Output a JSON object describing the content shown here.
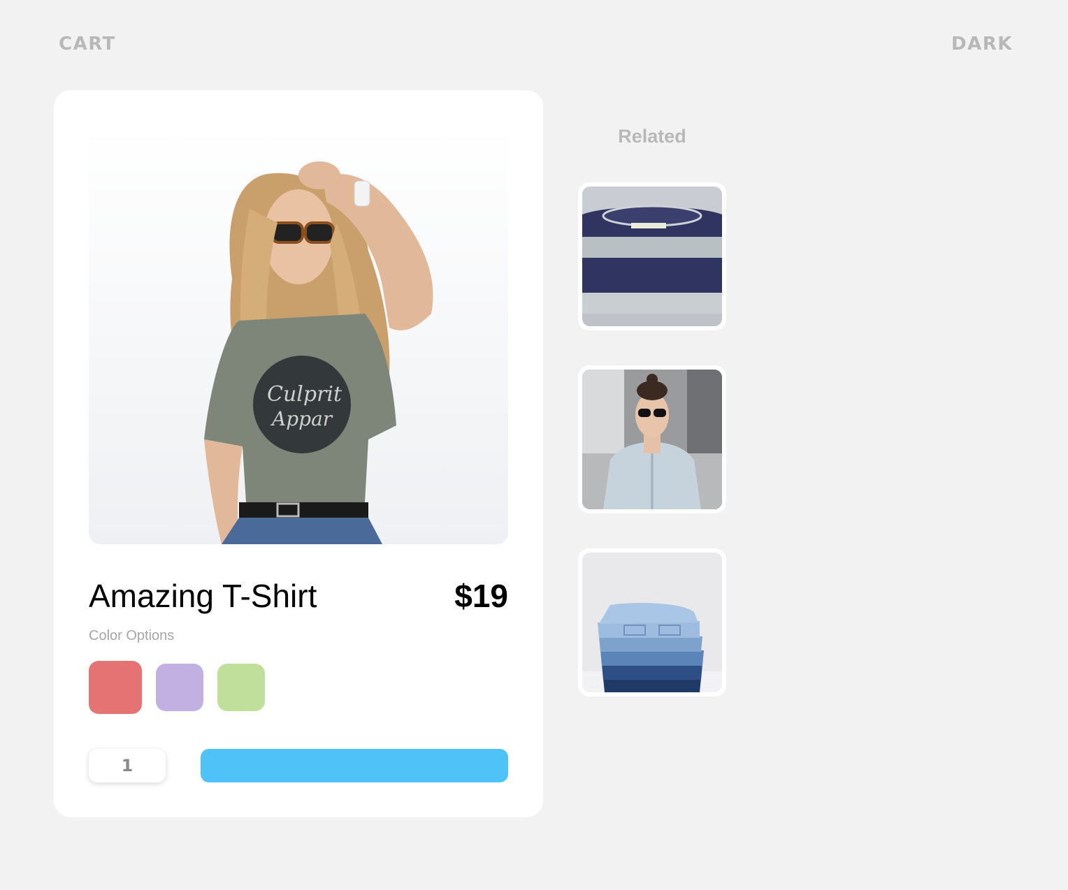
{
  "header": {
    "cart_label": "CART",
    "theme_label": "DARK"
  },
  "product": {
    "title": "Amazing T-Shirt",
    "price": "$19",
    "color_options_label": "Color Options",
    "image_icon": "model-tshirt-photo",
    "colors": [
      "#e57373",
      "#c2b0e2",
      "#bfdf9a"
    ],
    "quantity": "1",
    "add_button_color": "#4fc3f7"
  },
  "related": {
    "title": "Related",
    "items": [
      {
        "image_icon": "striped-sweater-photo"
      },
      {
        "image_icon": "denim-jacket-model-photo"
      },
      {
        "image_icon": "stacked-jeans-photo"
      }
    ]
  }
}
